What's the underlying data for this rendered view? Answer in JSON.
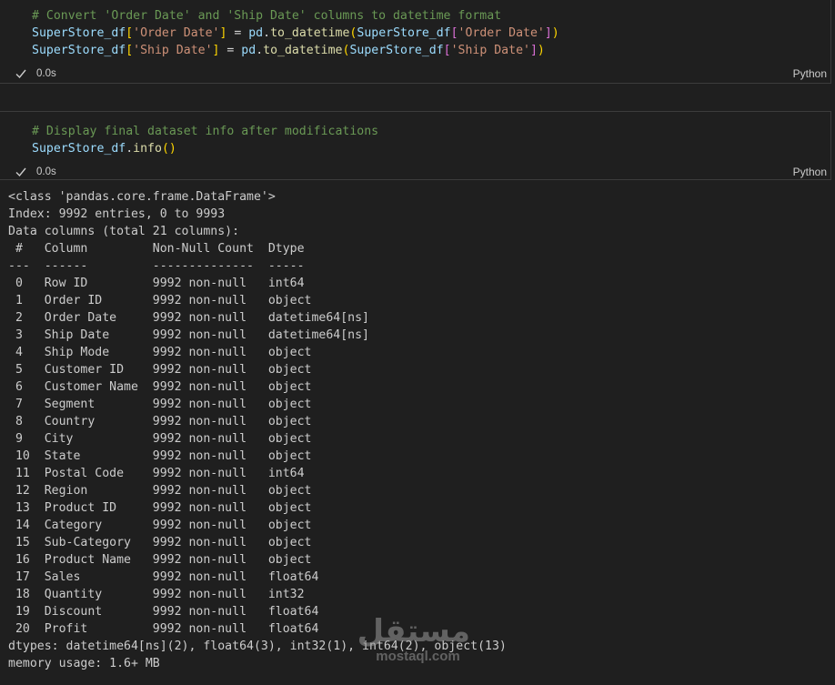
{
  "cell1": {
    "lines": [
      [
        {
          "t": "# Convert 'Order Date' and 'Ship Date' columns to datetime format",
          "c": "comment"
        }
      ],
      [
        {
          "t": "SuperStore_df",
          "c": "var"
        },
        {
          "t": "[",
          "c": "punct"
        },
        {
          "t": "'Order Date'",
          "c": "str"
        },
        {
          "t": "]",
          "c": "punct"
        },
        {
          "t": " = ",
          "c": "op"
        },
        {
          "t": "pd",
          "c": "var"
        },
        {
          "t": ".",
          "c": "op"
        },
        {
          "t": "to_datetime",
          "c": "fn"
        },
        {
          "t": "(",
          "c": "punct"
        },
        {
          "t": "SuperStore_df",
          "c": "var"
        },
        {
          "t": "[",
          "c": "punct2"
        },
        {
          "t": "'Order Date'",
          "c": "str"
        },
        {
          "t": "]",
          "c": "punct2"
        },
        {
          "t": ")",
          "c": "punct"
        }
      ],
      [
        {
          "t": "SuperStore_df",
          "c": "var"
        },
        {
          "t": "[",
          "c": "punct"
        },
        {
          "t": "'Ship Date'",
          "c": "str"
        },
        {
          "t": "]",
          "c": "punct"
        },
        {
          "t": " = ",
          "c": "op"
        },
        {
          "t": "pd",
          "c": "var"
        },
        {
          "t": ".",
          "c": "op"
        },
        {
          "t": "to_datetime",
          "c": "fn"
        },
        {
          "t": "(",
          "c": "punct"
        },
        {
          "t": "SuperStore_df",
          "c": "var"
        },
        {
          "t": "[",
          "c": "punct2"
        },
        {
          "t": "'Ship Date'",
          "c": "str"
        },
        {
          "t": "]",
          "c": "punct2"
        },
        {
          "t": ")",
          "c": "punct"
        }
      ]
    ],
    "status_time": "0.0s",
    "language": "Python",
    "status_icon": "checkmark-icon"
  },
  "cell2": {
    "lines": [
      [
        {
          "t": "# Display final dataset info after modifications",
          "c": "comment"
        }
      ],
      [
        {
          "t": "SuperStore_df",
          "c": "var"
        },
        {
          "t": ".",
          "c": "op"
        },
        {
          "t": "info",
          "c": "fn"
        },
        {
          "t": "()",
          "c": "punct"
        }
      ]
    ],
    "status_time": "0.0s",
    "language": "Python",
    "status_icon": "checkmark-icon"
  },
  "output": {
    "lines": [
      "<class 'pandas.core.frame.DataFrame'>",
      "Index: 9992 entries, 0 to 9993",
      "Data columns (total 21 columns):",
      " #   Column         Non-Null Count  Dtype         ",
      "---  ------         --------------  -----         ",
      " 0   Row ID         9992 non-null   int64         ",
      " 1   Order ID       9992 non-null   object        ",
      " 2   Order Date     9992 non-null   datetime64[ns]",
      " 3   Ship Date      9992 non-null   datetime64[ns]",
      " 4   Ship Mode      9992 non-null   object        ",
      " 5   Customer ID    9992 non-null   object        ",
      " 6   Customer Name  9992 non-null   object        ",
      " 7   Segment        9992 non-null   object        ",
      " 8   Country        9992 non-null   object        ",
      " 9   City           9992 non-null   object        ",
      " 10  State          9992 non-null   object        ",
      " 11  Postal Code    9992 non-null   int64         ",
      " 12  Region         9992 non-null   object        ",
      " 13  Product ID     9992 non-null   object        ",
      " 14  Category       9992 non-null   object        ",
      " 15  Sub-Category   9992 non-null   object        ",
      " 16  Product Name   9992 non-null   object        ",
      " 17  Sales          9992 non-null   float64       ",
      " 18  Quantity       9992 non-null   int32         ",
      " 19  Discount       9992 non-null   float64       ",
      " 20  Profit         9992 non-null   float64       ",
      "dtypes: datetime64[ns](2), float64(3), int32(1), int64(2), object(13)",
      "memory usage: 1.6+ MB"
    ]
  },
  "watermark": {
    "logo_text": "مستقل",
    "sub_text": "mostaql.com"
  }
}
